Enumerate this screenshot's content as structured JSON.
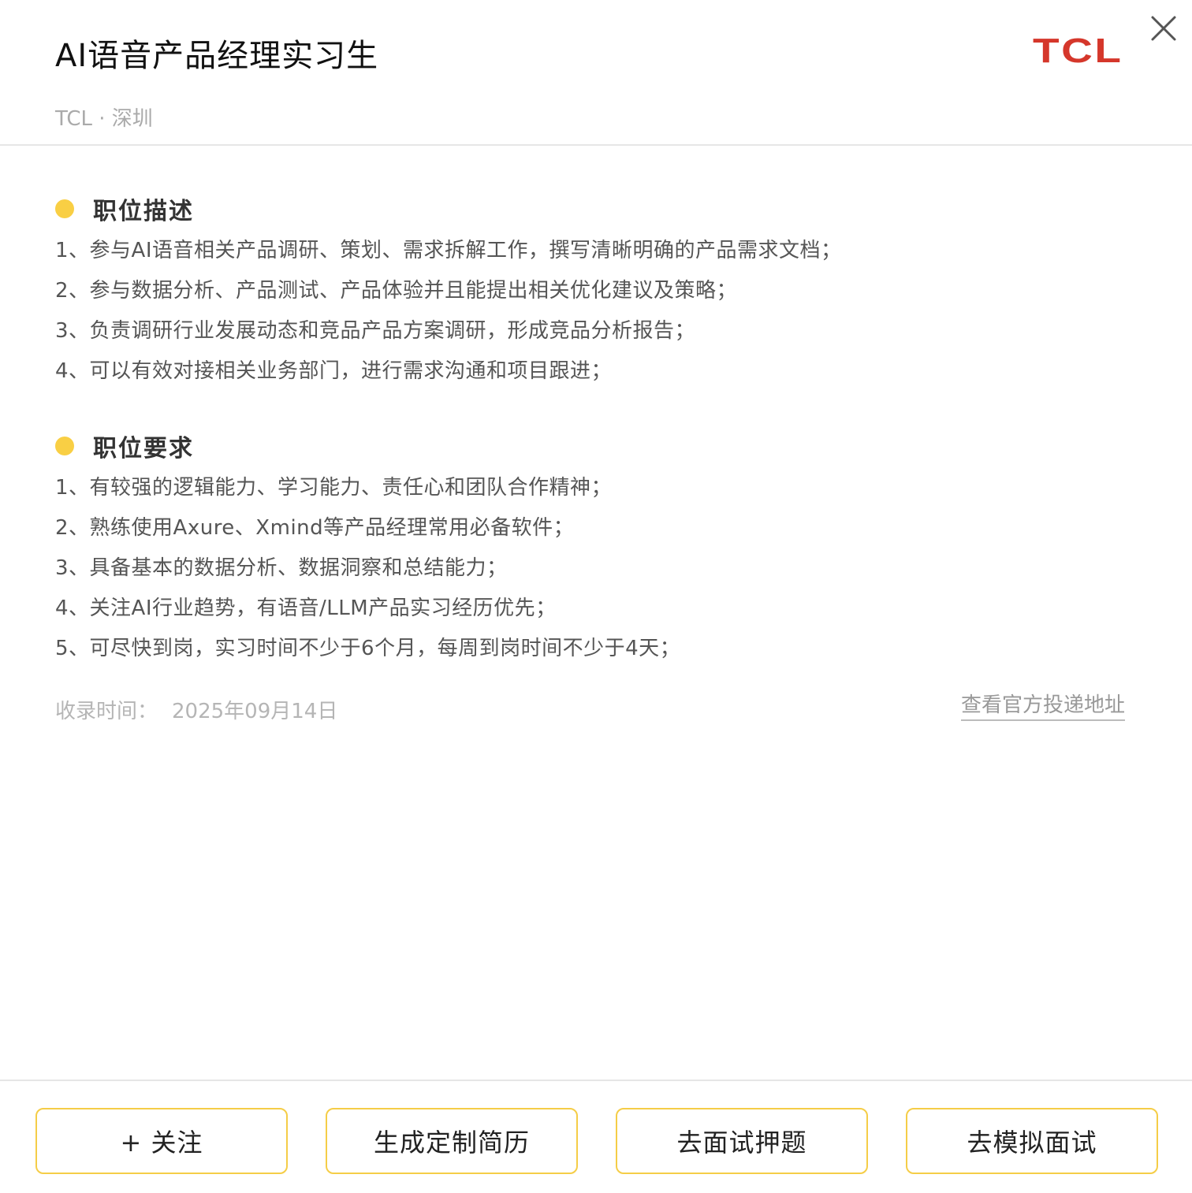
{
  "header": {
    "job_title": "AI语音产品经理实习生",
    "company_logo_text": "TCL",
    "company_location": "TCL · 深圳",
    "close_icon": "close-icon",
    "logo_color": "#d5372b"
  },
  "description": {
    "title": "职位描述",
    "items": [
      "1、参与AI语音相关产品调研、策划、需求拆解工作，撰写清晰明确的产品需求文档；",
      "2、参与数据分析、产品测试、产品体验并且能提出相关优化建议及策略；",
      "3、负责调研行业发展动态和竞品产品方案调研，形成竞品分析报告；",
      "4、可以有效对接相关业务部门，进行需求沟通和项目跟进；"
    ]
  },
  "requirements": {
    "title": "职位要求",
    "items": [
      "1、有较强的逻辑能力、学习能力、责任心和团队合作精神；",
      "2、熟练使用Axure、Xmind等产品经理常用必备软件；",
      "3、具备基本的数据分析、数据洞察和总结能力；",
      "4、关注AI行业趋势，有语音/LLM产品实习经历优先；",
      "5、可尽快到岗，实习时间不少于6个月，每周到岗时间不少于4天；"
    ]
  },
  "meta": {
    "collected_label": "收录时间：",
    "collected_date": "2025年09月14日",
    "official_link": "查看官方投递地址"
  },
  "footer": {
    "follow": "+ 关注",
    "resume": "生成定制简历",
    "interview_questions": "去面试押题",
    "mock_interview": "去模拟面试"
  },
  "colors": {
    "accent": "#f9cf44",
    "button_border": "#f5cd47"
  }
}
